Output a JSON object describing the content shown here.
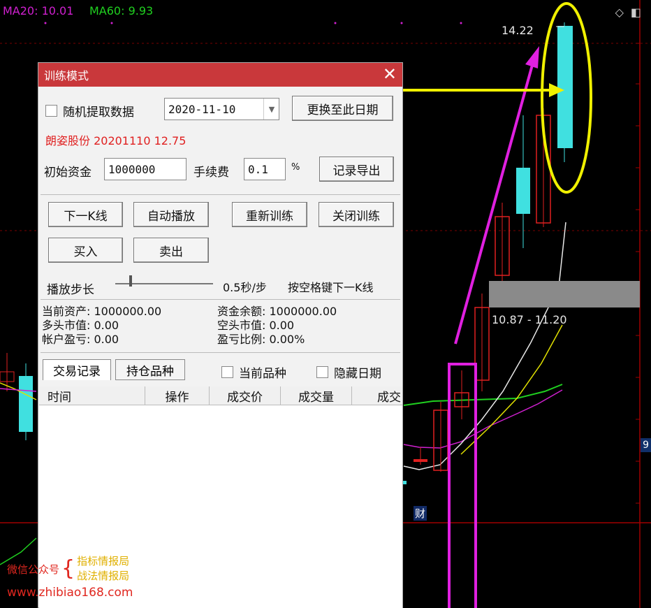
{
  "chart": {
    "ma20_label": "MA20: 10.01",
    "ma60_label": "MA60: 9.93",
    "high_price": "14.22",
    "range_label": "10.87 - 11.20",
    "cai_marker": "财",
    "right_value": "9",
    "colors": {
      "ma20": "#d020d0",
      "ma60": "#20d020",
      "up": "#e02020",
      "down": "#40e0e0",
      "grid": "#8b0000"
    }
  },
  "dialog": {
    "title": "训练模式",
    "random_label": "随机提取数据",
    "date_value": "2020-11-10",
    "change_date_button": "更换至此日期",
    "stock_info": "朗姿股份 20201110 12.75",
    "capital_label": "初始资金",
    "capital_value": "1000000",
    "fee_label": "手续费",
    "fee_value": "0.1",
    "fee_unit": "%",
    "export_button": "记录导出",
    "next_k_button": "下一K线",
    "auto_play_button": "自动播放",
    "retrain_button": "重新训练",
    "close_train_button": "关闭训练",
    "buy_button": "买入",
    "sell_button": "卖出",
    "step_label": "播放步长",
    "step_value": "0.5秒/步",
    "space_hint": "按空格键下一K线",
    "stats": {
      "current_assets": "当前资产: 1000000.00",
      "cash_balance": "资金余额: 1000000.00",
      "long_value": "多头市值: 0.00",
      "short_value": "空头市值: 0.00",
      "account_pnl": "帐户盈亏: 0.00",
      "pnl_ratio": "盈亏比例: 0.00%"
    },
    "tabs": {
      "trade_records": "交易记录",
      "positions": "持仓品种"
    },
    "current_item_label": "当前品种",
    "hide_date_label": "隐藏日期",
    "columns": [
      "时间",
      "操作",
      "成交价",
      "成交量",
      "成交"
    ]
  },
  "watermark": {
    "account_label": "微信公众号",
    "name1": "指标情报局",
    "name2": "战法情报局",
    "url": "www.zhibiao168.com"
  }
}
